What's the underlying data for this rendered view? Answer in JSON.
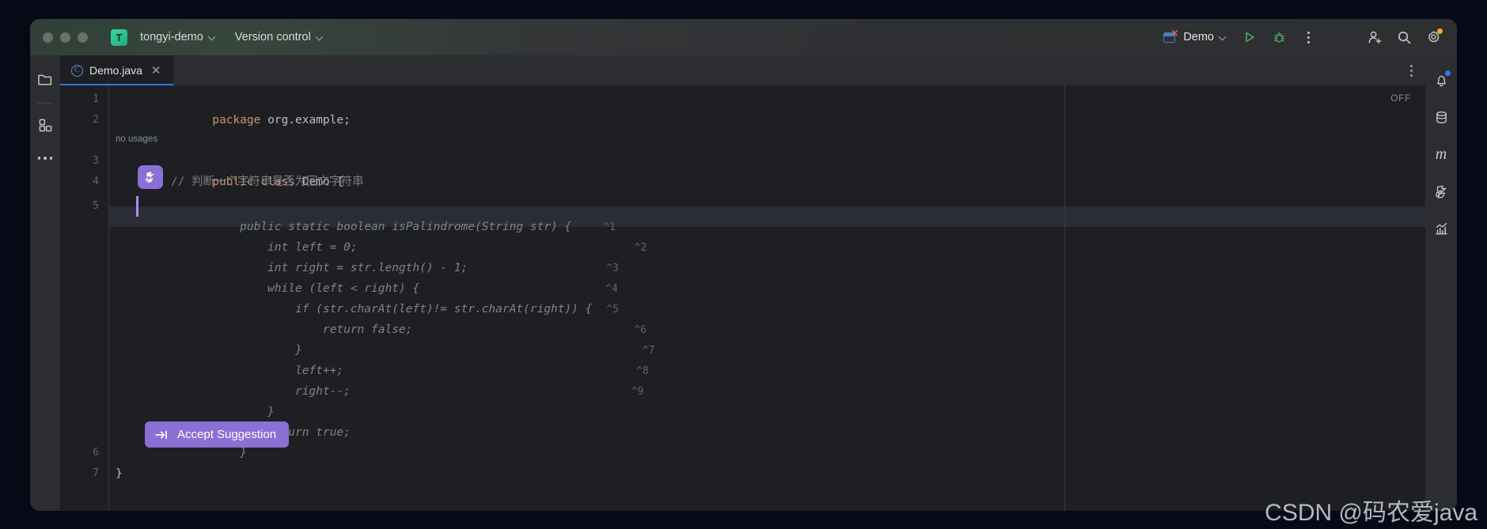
{
  "window": {
    "project_name": "tongyi-demo",
    "project_initial": "T",
    "vcs_label": "Version control",
    "run_config": "Demo",
    "traffic_lights": [
      "close",
      "minimize",
      "zoom"
    ]
  },
  "toolbar": {
    "run_icon": "run-icon",
    "debug_icon": "debug-icon",
    "more_icon": "more-vertical-icon",
    "account_icon": "add-account-icon",
    "search_icon": "search-icon",
    "settings_icon": "gear-icon"
  },
  "left_sidebar": {
    "items": [
      {
        "icon": "project-folder-icon",
        "name": "project-tool-window"
      },
      {
        "icon": "structure-blocks-icon",
        "name": "structure-tool-window"
      },
      {
        "icon": "more-horizontal-icon",
        "name": "more-tool-windows"
      }
    ]
  },
  "right_sidebar": {
    "items": [
      {
        "icon": "notifications-bell-icon",
        "name": "notifications",
        "badge": true
      },
      {
        "icon": "database-icon",
        "name": "database-tool-window",
        "badge": false
      },
      {
        "icon": "maven-m-icon",
        "name": "maven-tool-window",
        "badge": false,
        "glyph": "m"
      },
      {
        "icon": "tongyi-lingma-icon",
        "name": "tongyi-lingma-tool-window",
        "badge": false
      },
      {
        "icon": "profiler-chart-icon",
        "name": "profiler-tool-window",
        "badge": false
      }
    ]
  },
  "editor": {
    "tab": {
      "label": "Demo.java",
      "file_type_icon": "java-class-icon",
      "close_icon": "close-icon"
    },
    "tab_more_icon": "more-vertical-icon",
    "inspection_widget": "OFF",
    "inlay_hint": "no usages",
    "gutter_lines": [
      "1",
      "2",
      "3",
      "4",
      "5",
      "6",
      "7"
    ],
    "lines": [
      {
        "n": 1,
        "segments": [
          {
            "t": "package ",
            "c": "kw"
          },
          {
            "t": "org.example;",
            "c": "plain"
          }
        ]
      },
      {
        "n": 2,
        "segments": []
      },
      {
        "n": 3,
        "segments": [
          {
            "t": "public class ",
            "c": "kw"
          },
          {
            "t": "Demo {",
            "c": "cls"
          }
        ]
      },
      {
        "n": 4,
        "segments": [
          {
            "t": "        // 判断一个字符串是否为回文字符串",
            "c": "cmt"
          }
        ]
      },
      {
        "n": 7,
        "segments": [
          {
            "t": "}",
            "c": "plain"
          }
        ]
      }
    ],
    "suggestion": {
      "accept_button_label": "Accept Suggestion",
      "accept_button_icon": "tab-key-icon",
      "ai_badge_icon": "tongyi-lingma-icon",
      "ghost_lines": [
        {
          "code": "    public static boolean isPalindrome(String str) {",
          "hint": "^1"
        },
        {
          "code": "        int left = 0;",
          "hint": "^2"
        },
        {
          "code": "        int right = str.length() - 1;",
          "hint": "^3"
        },
        {
          "code": "        while (left < right) {",
          "hint": "^4"
        },
        {
          "code": "            if (str.charAt(left)!= str.charAt(right)) {",
          "hint": "^5"
        },
        {
          "code": "                return false;",
          "hint": "^6"
        },
        {
          "code": "            }",
          "hint": "^7"
        },
        {
          "code": "            left++;",
          "hint": "^8"
        },
        {
          "code": "            right--;",
          "hint": "^9"
        },
        {
          "code": "        }",
          "hint": ""
        },
        {
          "code": "        return true;",
          "hint": ""
        },
        {
          "code": "    }",
          "hint": ""
        }
      ]
    }
  },
  "watermark": "CSDN @码农爱java",
  "colors": {
    "accent_blue": "#3574f0",
    "ai_purple": "#8b6fd4",
    "keyword_orange": "#cf8e6d",
    "run_green": "#4eae5b",
    "editor_bg": "#1e1f22",
    "chrome_bg": "#2b2d30"
  }
}
